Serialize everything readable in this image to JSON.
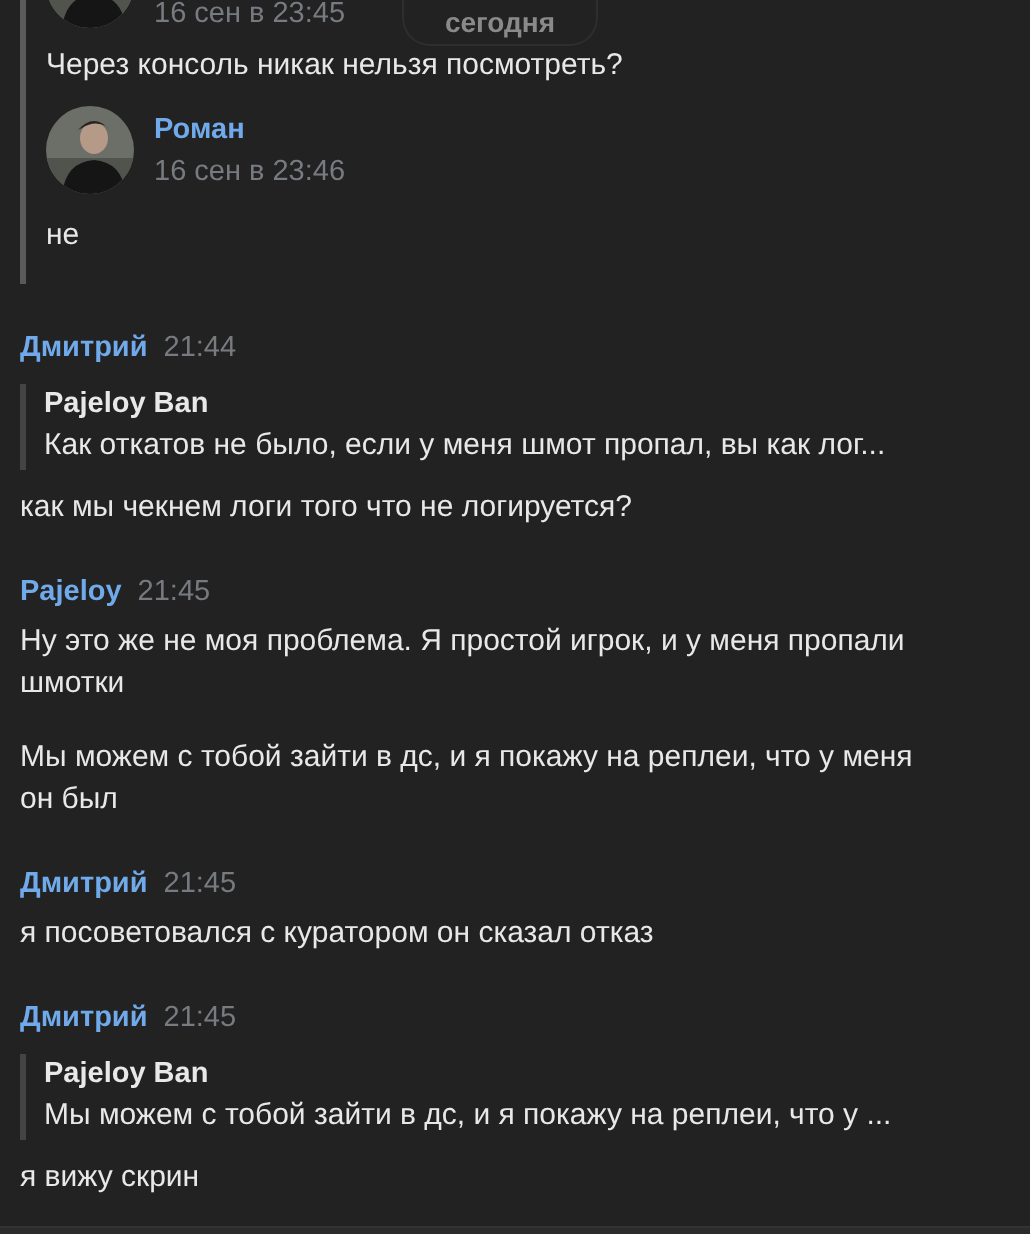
{
  "date_divider": "сегодня",
  "forwarded": {
    "time": "16 сен в 23:45",
    "text": "Через консоль никак нельзя посмотреть?",
    "reply": {
      "author": "Роман",
      "time": "16 сен в 23:46",
      "text": "не"
    }
  },
  "messages": [
    {
      "author": "Дмитрий",
      "time": "21:44",
      "quote": {
        "author": "Pajeloy Ban",
        "text": "Как откатов не было, если у меня шмот пропал, вы как лог..."
      },
      "paragraphs": [
        "как мы чекнем логи того что не логируется?"
      ]
    },
    {
      "author": "Pajeloy",
      "time": "21:45",
      "paragraphs": [
        "Ну это же не моя проблема. Я простой игрок, и у меня пропали шмотки",
        "Мы можем с тобой зайти в дс, и я покажу на реплеи, что у меня он был"
      ]
    },
    {
      "author": "Дмитрий",
      "time": "21:45",
      "paragraphs": [
        "я посоветовался с куратором он сказал отказ"
      ]
    },
    {
      "author": "Дмитрий",
      "time": "21:45",
      "quote": {
        "author": "Pajeloy Ban",
        "text": "Мы можем с тобой зайти в дс, и я покажу на реплеи, что у ..."
      },
      "paragraphs": [
        "я вижу скрин"
      ]
    }
  ]
}
